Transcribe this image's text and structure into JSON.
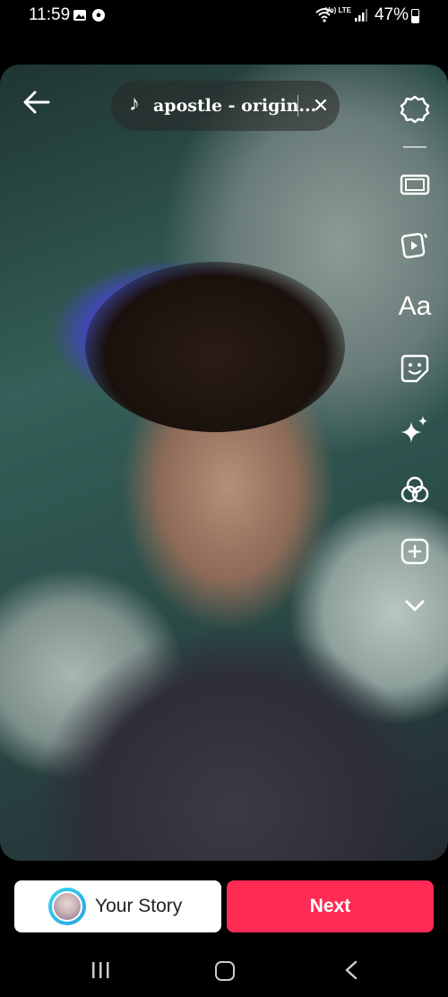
{
  "status_bar": {
    "time": "11:59",
    "lte_label": "Vo) LTE",
    "battery_percent": "47%",
    "battery_level": 0.47,
    "icons": [
      "image-icon",
      "soccer-icon",
      "wifi-icon",
      "signal-icon",
      "battery-icon"
    ]
  },
  "header": {
    "back_icon": "arrow-left-icon",
    "sound_title": "apostle - origin...",
    "sound_icon": "music-note-icon",
    "close_icon": "close-icon"
  },
  "toolbar": {
    "items": [
      {
        "name": "settings",
        "icon": "gear-icon"
      },
      {
        "name": "adjust-clips",
        "icon": "clips-icon"
      },
      {
        "name": "templates",
        "icon": "video-template-icon"
      },
      {
        "name": "text",
        "icon": "text-icon",
        "label": "Aa"
      },
      {
        "name": "stickers",
        "icon": "sticker-icon"
      },
      {
        "name": "effects",
        "icon": "sparkle-icon"
      },
      {
        "name": "filters",
        "icon": "filters-icon"
      },
      {
        "name": "add-overlay",
        "icon": "add-icon"
      },
      {
        "name": "more",
        "icon": "chevron-down-icon"
      }
    ]
  },
  "bottom": {
    "story_label": "Your Story",
    "next_label": "Next",
    "next_color": "#fe2c55"
  },
  "navbar": {
    "icons": [
      "recents-icon",
      "home-icon",
      "back-icon"
    ]
  }
}
